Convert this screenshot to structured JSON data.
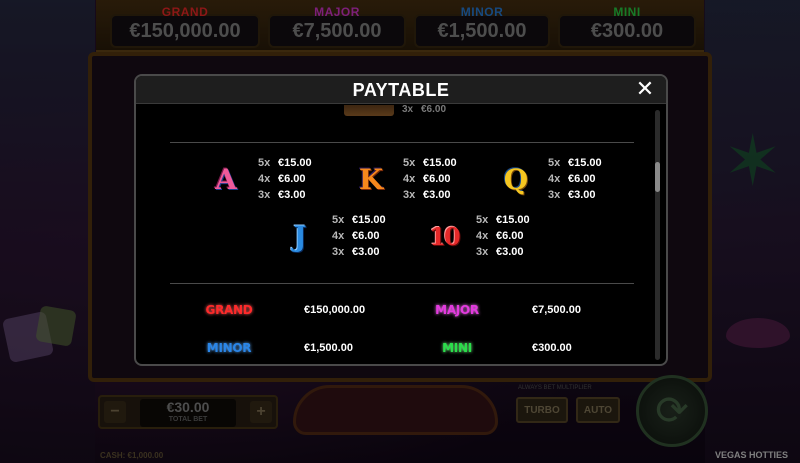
{
  "game": {
    "brand": "VEGAS HOTTIES",
    "cash_label": "CASH: €1,000.00"
  },
  "top_jackpots": [
    {
      "name": "GRAND",
      "value": "€150,000.00",
      "color": "#ff2a2a"
    },
    {
      "name": "MAJOR",
      "value": "€7,500.00",
      "color": "#e43adf"
    },
    {
      "name": "MINOR",
      "value": "€1,500.00",
      "color": "#2a86e8"
    },
    {
      "name": "MINI",
      "value": "€300.00",
      "color": "#2adf4a"
    }
  ],
  "controls": {
    "bet_value": "€30.00",
    "bet_caption": "TOTAL BET",
    "minus": "−",
    "plus": "+",
    "turbo": "TURBO",
    "auto": "AUTO",
    "feature_note": "ALWAYS BET MULTIPLIER",
    "spin_icon": "spin-arrows-icon"
  },
  "paytable": {
    "title": "PAYTABLE",
    "close_icon": "close-icon",
    "previous_row": {
      "mult": "3x",
      "value": "€6.00"
    },
    "symbols": [
      {
        "id": "A",
        "glyph": "A",
        "pays": [
          {
            "m": "5x",
            "v": "€15.00"
          },
          {
            "m": "4x",
            "v": "€6.00"
          },
          {
            "m": "3x",
            "v": "€3.00"
          }
        ]
      },
      {
        "id": "K",
        "glyph": "K",
        "pays": [
          {
            "m": "5x",
            "v": "€15.00"
          },
          {
            "m": "4x",
            "v": "€6.00"
          },
          {
            "m": "3x",
            "v": "€3.00"
          }
        ]
      },
      {
        "id": "Q",
        "glyph": "Q",
        "pays": [
          {
            "m": "5x",
            "v": "€15.00"
          },
          {
            "m": "4x",
            "v": "€6.00"
          },
          {
            "m": "3x",
            "v": "€3.00"
          }
        ]
      },
      {
        "id": "J",
        "glyph": "J",
        "pays": [
          {
            "m": "5x",
            "v": "€15.00"
          },
          {
            "m": "4x",
            "v": "€6.00"
          },
          {
            "m": "3x",
            "v": "€3.00"
          }
        ]
      },
      {
        "id": "10",
        "glyph": "10",
        "pays": [
          {
            "m": "5x",
            "v": "€15.00"
          },
          {
            "m": "4x",
            "v": "€6.00"
          },
          {
            "m": "3x",
            "v": "€3.00"
          }
        ]
      }
    ],
    "jackpots": [
      {
        "name": "GRAND",
        "value": "€150,000.00"
      },
      {
        "name": "MAJOR",
        "value": "€7,500.00"
      },
      {
        "name": "MINOR",
        "value": "€1,500.00"
      },
      {
        "name": "MINI",
        "value": "€300.00"
      }
    ]
  }
}
